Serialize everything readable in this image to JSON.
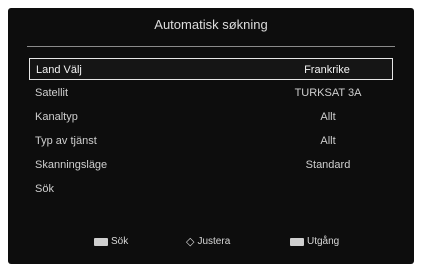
{
  "header": {
    "title": "Automatisk søkning"
  },
  "menu": [
    {
      "label": "Land Välj",
      "value": "Frankrike",
      "selected": true
    },
    {
      "label": "Satellit",
      "value": "TURKSAT 3A",
      "selected": false
    },
    {
      "label": "Kanaltyp",
      "value": "Allt",
      "selected": false
    },
    {
      "label": "Typ av tjänst",
      "value": "Allt",
      "selected": false
    },
    {
      "label": "Skanningsläge",
      "value": "Standard",
      "selected": false
    },
    {
      "label": "Sök",
      "value": "",
      "selected": false
    }
  ],
  "footer": {
    "ok_label": "Sök",
    "adjust_label": "Justera",
    "exit_label": "Utgång",
    "ok_icon": "ok-key-icon",
    "adjust_icon": "left-right-arrows-icon",
    "exit_icon": "exit-key-icon"
  }
}
